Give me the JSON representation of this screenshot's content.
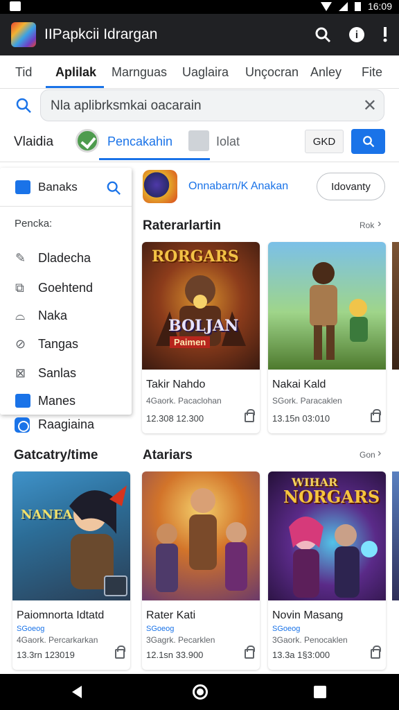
{
  "status_bar": {
    "time": "16:09"
  },
  "app_bar": {
    "title": "IIPapkcii Idrargan",
    "icons": [
      "app-logo",
      "search-icon",
      "info-icon",
      "overflow-menu-icon"
    ]
  },
  "tabs": [
    "Tid",
    "Aplilak",
    "Marnguas",
    "Uaglaira",
    "Unçocran",
    "Anley",
    "Fite"
  ],
  "search": {
    "value": "Nla aplibrksmkai oacarain"
  },
  "filters": {
    "label": "Vlaidia",
    "chip": "Pencakahin",
    "secondary": "Iolat",
    "button": "GKD"
  },
  "menu": {
    "header": "Banaks",
    "subtitle": "Pencka:",
    "items": [
      "Dladecha",
      "Goehtend",
      "Naka",
      "Tangas",
      "Sanlas",
      "Manes"
    ],
    "below": "Raagiaina"
  },
  "promo": {
    "text": "Onnabarn/K Anakan",
    "button": "Idovanty"
  },
  "section1": {
    "title": "Raterarlartin",
    "more": "Rok"
  },
  "section2": {
    "title": "Atariars",
    "more": "Gon"
  },
  "left_section": {
    "title": "Gatcatry/time"
  },
  "cards_row1": [
    {
      "name": "Takir Nahdo",
      "sub": "4Gaork. Pacaclohan",
      "meta": "12.308  12.300",
      "art_text": "RORGARS",
      "art_text2": "BOLJAN",
      "art_text3": "Paimen"
    },
    {
      "name": "Nakai Kald",
      "sub": "SGork. Paracaklen",
      "meta": "13.15n  03:010",
      "art_text": "",
      "art_text2": "",
      "art_text3": ""
    }
  ],
  "cards_row2": [
    {
      "name": "Paiomnorta Idtatd",
      "tag": "SGoeog",
      "sub": "4Gaork. Percarkarkan",
      "meta": "13.3rn  123019",
      "art_text": "NANEA"
    },
    {
      "name": "Rater Kati",
      "tag": "SGoeog",
      "sub": "3Gagrk. Pecarklen",
      "meta": "12.1sn  33.900",
      "art_text": ""
    },
    {
      "name": "Novin Masang",
      "tag": "SGoeog",
      "sub": "3Gaork. Penocaklen",
      "meta": "13.3a  1§3:000",
      "art_text": "WIHAR",
      "art_text2": "NORGARS"
    }
  ]
}
